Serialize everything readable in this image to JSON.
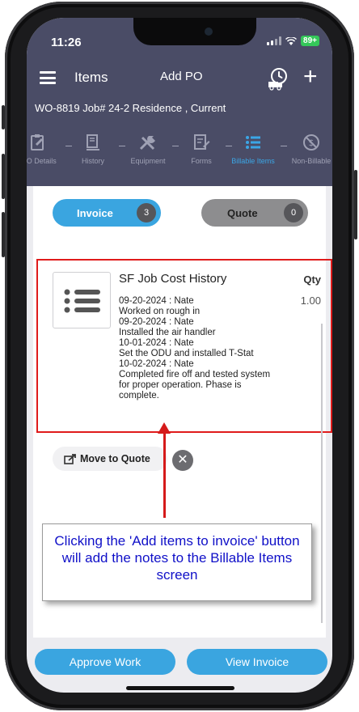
{
  "status": {
    "time": "11:26",
    "battery": "89+"
  },
  "nav": {
    "title": "Items",
    "center": "Add PO"
  },
  "work_order": {
    "text": "WO-8819  Job# 24-2  Residence , Current"
  },
  "tabs": [
    {
      "label": "WO Details"
    },
    {
      "label": "History"
    },
    {
      "label": "Equipment"
    },
    {
      "label": "Forms"
    },
    {
      "label": "Billable Items"
    },
    {
      "label": "Non-Billable"
    }
  ],
  "toggle": {
    "invoice_label": "Invoice",
    "invoice_count": "3",
    "quote_label": "Quote",
    "quote_count": "0"
  },
  "item": {
    "title": "SF Job Cost History",
    "qty_header": "Qty",
    "qty": "1.00",
    "notes": [
      "09-20-2024 : Nate",
      "Worked on rough in",
      "09-20-2024 : Nate",
      "Installed the air handler",
      "10-01-2024 : Nate",
      "Set the ODU and installed T-Stat",
      "10-02-2024 : Nate",
      "Completed fire off and tested system",
      "for proper operation. Phase is",
      "complete."
    ]
  },
  "actions": {
    "move_to_quote": "Move to Quote"
  },
  "callout": {
    "text": "Clicking the 'Add items to invoice' button will add the notes to the Billable Items screen"
  },
  "bottom": {
    "approve": "Approve Work",
    "view_invoice": "View Invoice"
  },
  "colors": {
    "header": "#4a4c66",
    "accent": "#3aa5e0",
    "highlight": "#e01b1b",
    "callout_text": "#1010c8"
  }
}
